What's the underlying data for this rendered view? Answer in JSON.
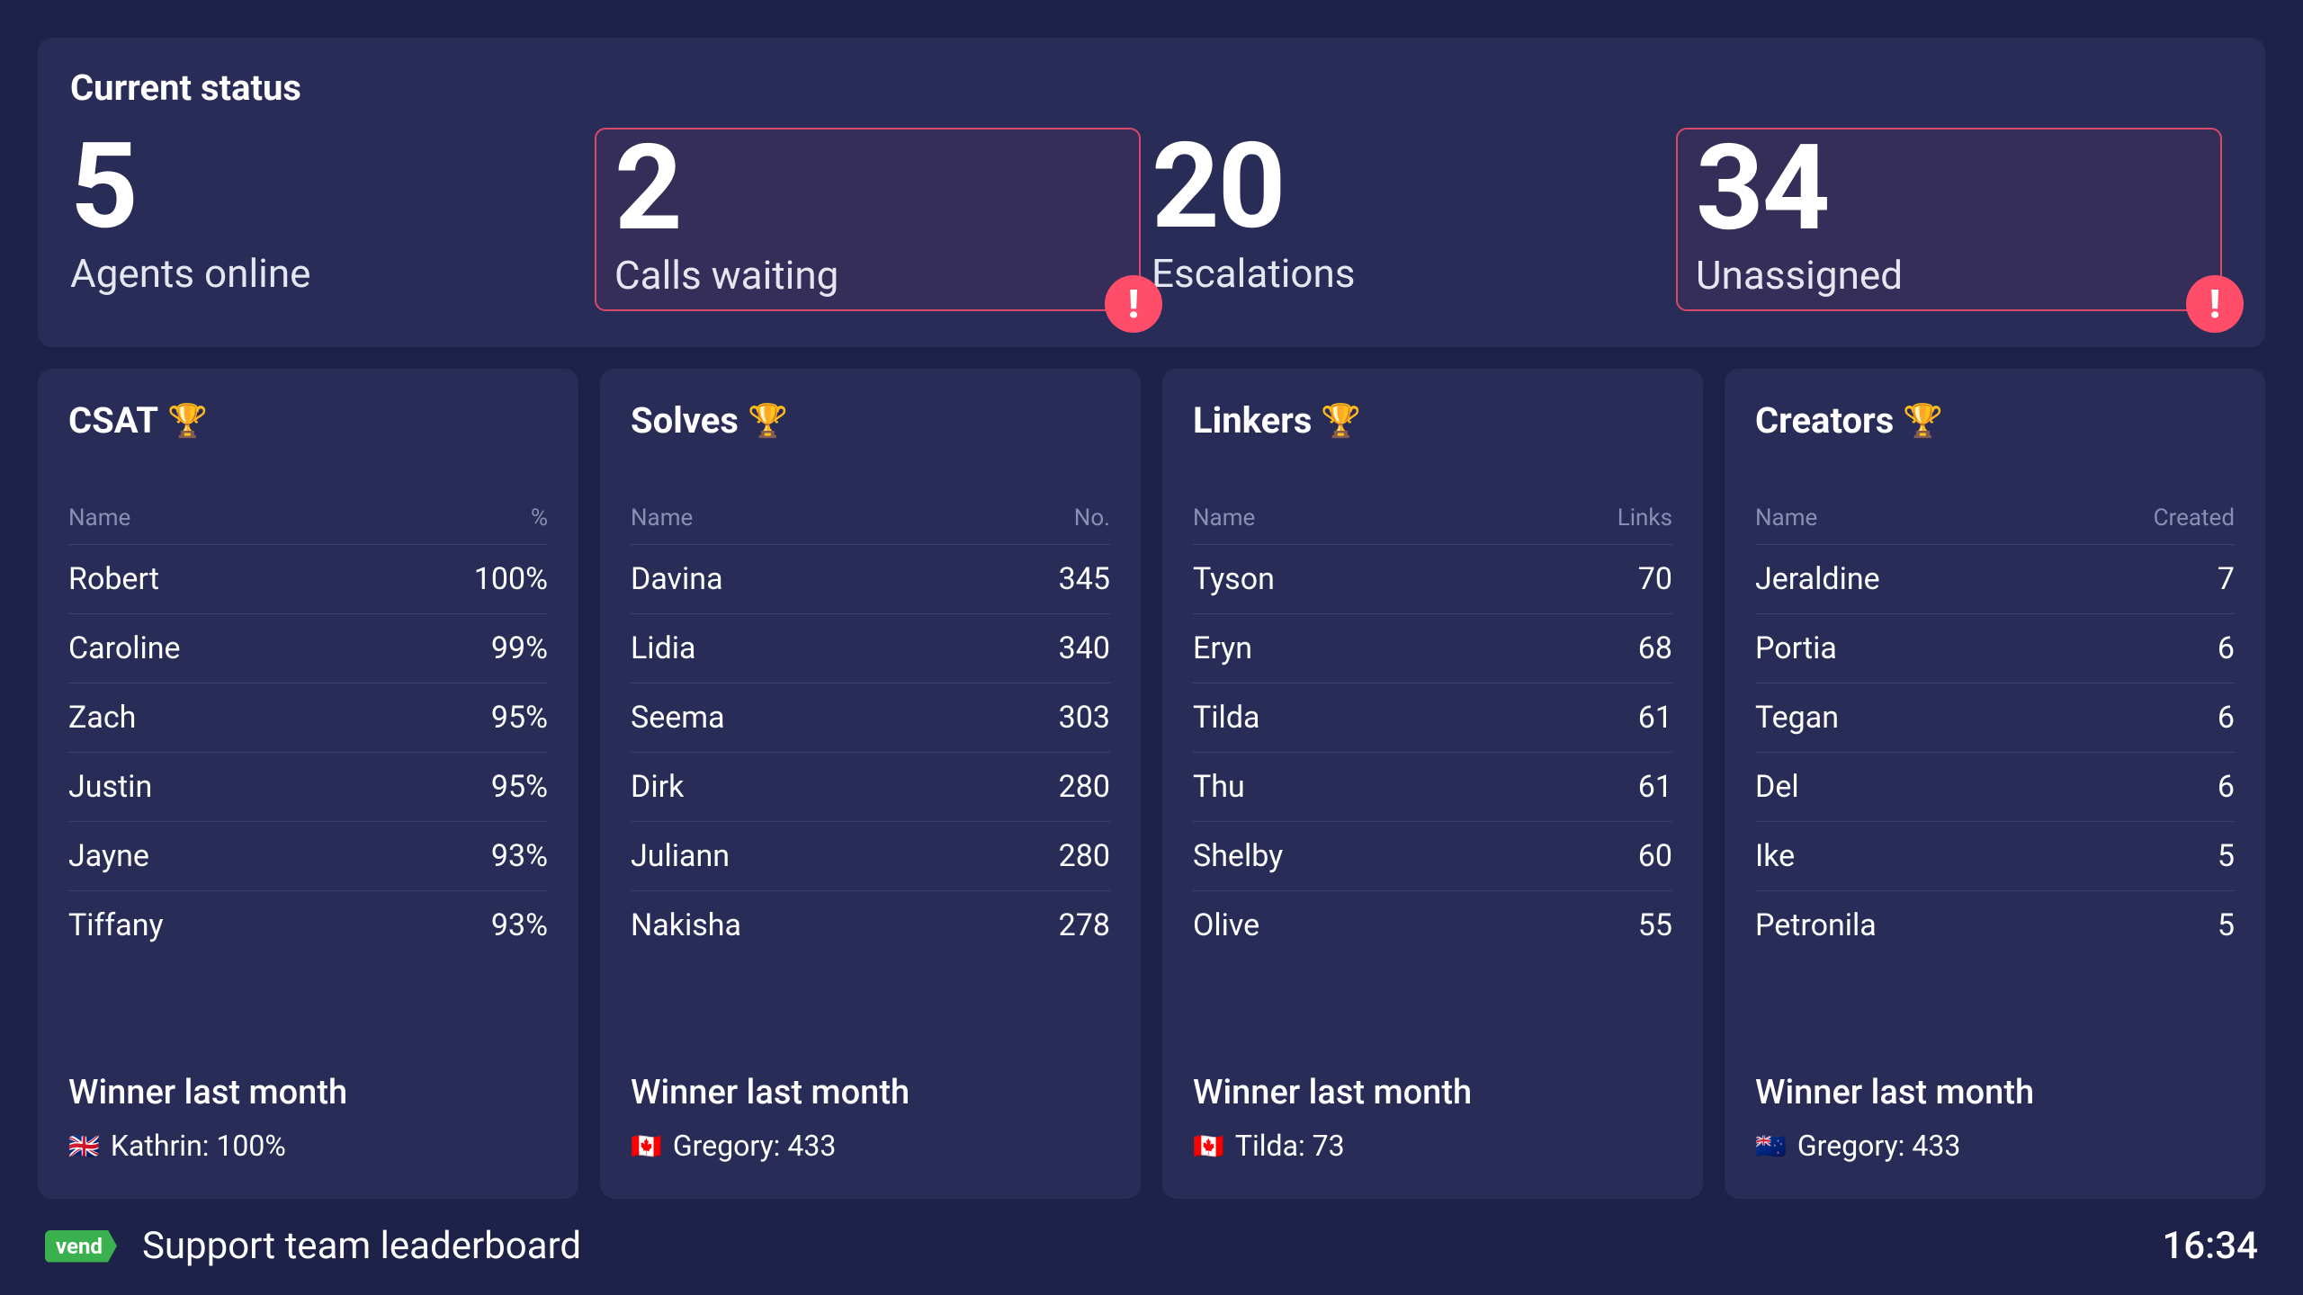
{
  "header": {
    "title": "Current status"
  },
  "status": [
    {
      "value": "5",
      "label": "Agents online",
      "alert": false
    },
    {
      "value": "2",
      "label": "Calls waiting",
      "alert": true
    },
    {
      "value": "20",
      "label": "Escalations",
      "alert": false
    },
    {
      "value": "34",
      "label": "Unassigned",
      "alert": true
    }
  ],
  "boards": [
    {
      "title": "CSAT",
      "col_name": "Name",
      "col_value": "%",
      "rows": [
        {
          "name": "Robert",
          "value": "100%"
        },
        {
          "name": "Caroline",
          "value": "99%"
        },
        {
          "name": "Zach",
          "value": "95%"
        },
        {
          "name": "Justin",
          "value": "95%"
        },
        {
          "name": "Jayne",
          "value": "93%"
        },
        {
          "name": "Tiffany",
          "value": "93%"
        }
      ],
      "winner_label": "Winner last month",
      "winner_flag": "🇬🇧",
      "winner_text": "Kathrin: 100%"
    },
    {
      "title": "Solves",
      "col_name": "Name",
      "col_value": "No.",
      "rows": [
        {
          "name": "Davina",
          "value": "345"
        },
        {
          "name": "Lidia",
          "value": "340"
        },
        {
          "name": "Seema",
          "value": "303"
        },
        {
          "name": "Dirk",
          "value": "280"
        },
        {
          "name": "Juliann",
          "value": "280"
        },
        {
          "name": "Nakisha",
          "value": "278"
        }
      ],
      "winner_label": "Winner last month",
      "winner_flag": "🇨🇦",
      "winner_text": "Gregory: 433"
    },
    {
      "title": "Linkers",
      "col_name": "Name",
      "col_value": "Links",
      "rows": [
        {
          "name": "Tyson",
          "value": "70"
        },
        {
          "name": "Eryn",
          "value": "68"
        },
        {
          "name": "Tilda",
          "value": "61"
        },
        {
          "name": "Thu",
          "value": "61"
        },
        {
          "name": "Shelby",
          "value": "60"
        },
        {
          "name": "Olive",
          "value": "55"
        }
      ],
      "winner_label": "Winner last month",
      "winner_flag": "🇨🇦",
      "winner_text": "Tilda: 73"
    },
    {
      "title": "Creators",
      "col_name": "Name",
      "col_value": "Created",
      "rows": [
        {
          "name": "Jeraldine",
          "value": "7"
        },
        {
          "name": "Portia",
          "value": "6"
        },
        {
          "name": "Tegan",
          "value": "6"
        },
        {
          "name": "Del",
          "value": "6"
        },
        {
          "name": "Ike",
          "value": "5"
        },
        {
          "name": "Petronila",
          "value": "5"
        }
      ],
      "winner_label": "Winner last month",
      "winner_flag": "🇳🇿",
      "winner_text": "Gregory: 433"
    }
  ],
  "footer": {
    "brand": "vend",
    "page_title": "Support team leaderboard",
    "time": "16:34"
  },
  "icons": {
    "trophy": "🏆",
    "alert": "!"
  }
}
